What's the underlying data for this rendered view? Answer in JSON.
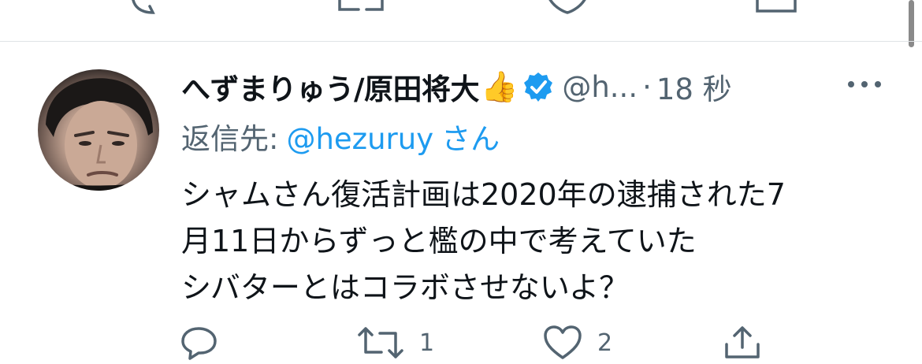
{
  "tweet": {
    "display_name": "へずまりゅう/原田将大",
    "name_emoji": "👍",
    "handle": "@h...",
    "separator": "·",
    "time": "18 秒",
    "reply_label": "返信先:",
    "reply_mention": "@hezuruy",
    "reply_suffix": "さん",
    "text_lines": [
      "シャムさん復活計画は2020年の逮捕された7",
      "月11日からずっと檻の中で考えていた",
      "シバターとはコラボさせないよ？"
    ],
    "actions": {
      "reply_count": "",
      "retweet_count": "1",
      "like_count": "2"
    }
  },
  "colors": {
    "verified": "#1d9bf0",
    "link": "#1d9bf0",
    "secondary_text": "#536471",
    "divider": "#dfe3e6"
  },
  "icons": {
    "reply": "speech-bubble-icon",
    "retweet": "retweet-arrows-icon",
    "like": "heart-icon",
    "share": "share-upload-icon",
    "more": "ellipsis-icon",
    "verified": "verified-badge-icon"
  }
}
